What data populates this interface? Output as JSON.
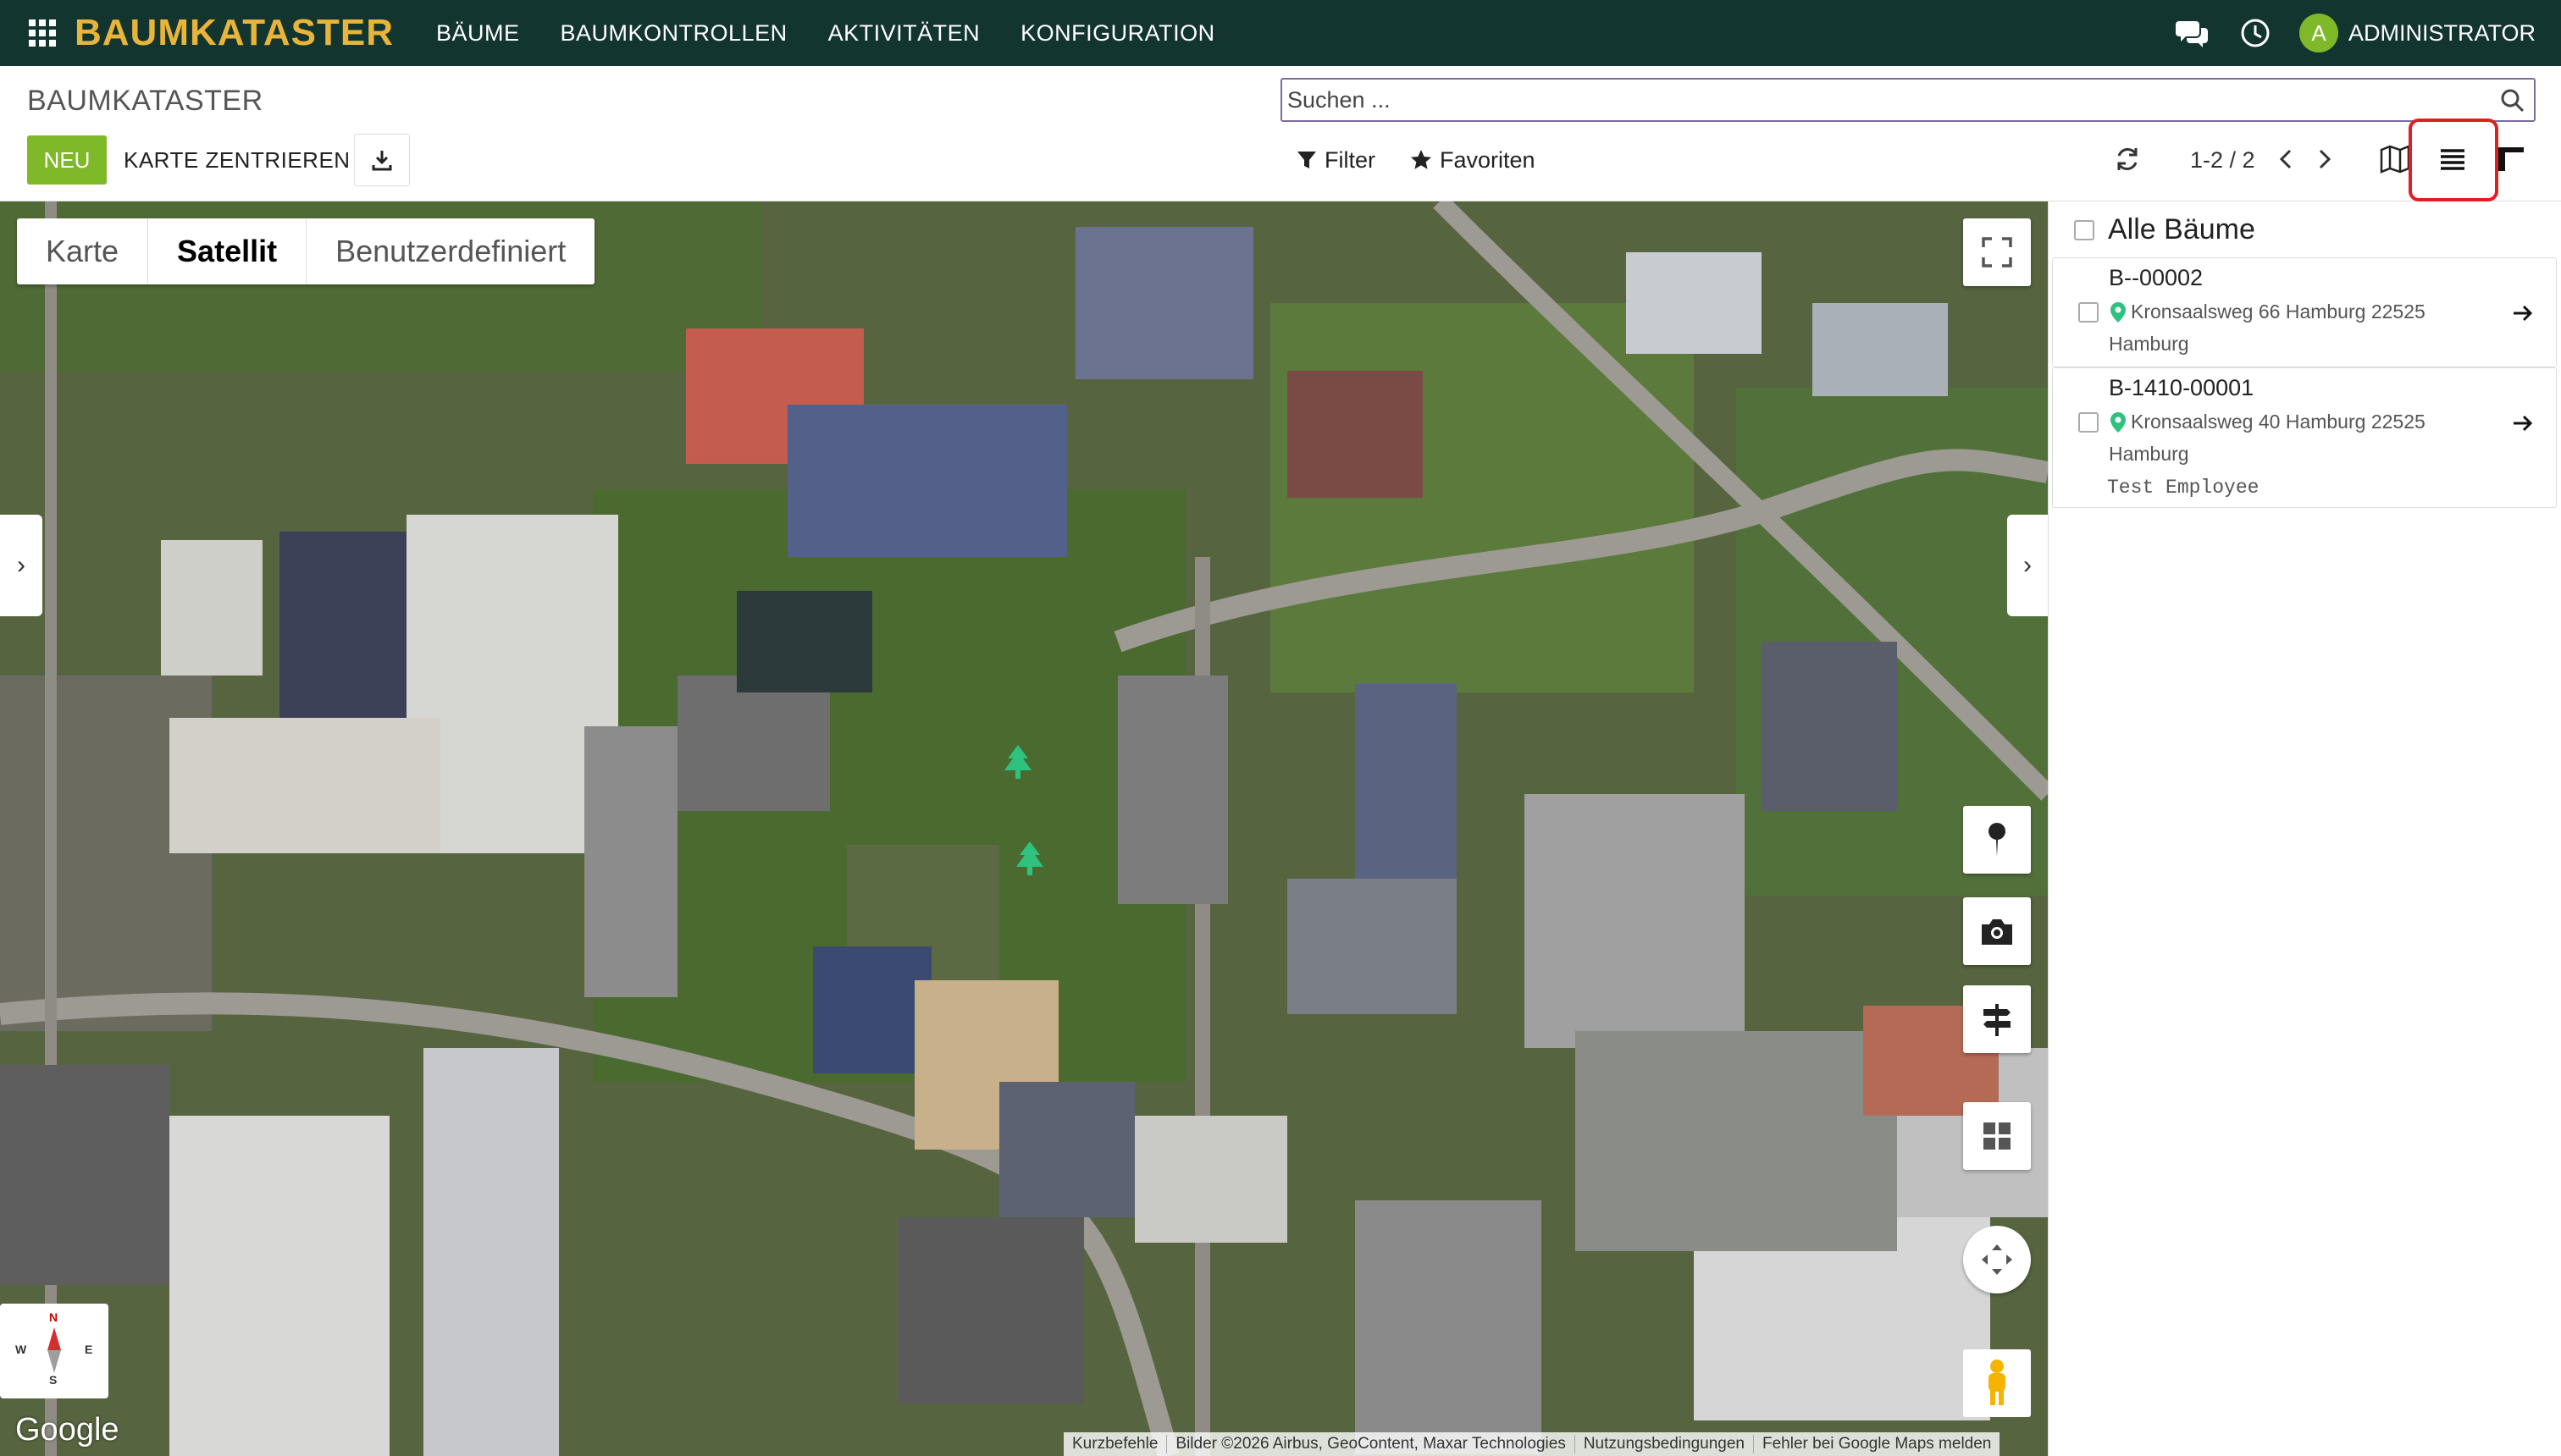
{
  "navbar": {
    "brand": "BAUMKATASTER",
    "menu": [
      "BÄUME",
      "BAUMKONTROLLEN",
      "AKTIVITÄTEN",
      "KONFIGURATION"
    ],
    "avatar_initial": "A",
    "user": "ADMINISTRATOR",
    "bg_color": "#13352f",
    "brand_color": "#e8b43a"
  },
  "control_panel": {
    "breadcrumb": "BAUMKATASTER",
    "search_placeholder": "Suchen ...",
    "new_label": "NEU",
    "center_label": "KARTE ZENTRIEREN",
    "filter_label": "Filter",
    "favorites_label": "Favoriten",
    "pager": "1-2 / 2",
    "accent_color": "#7fb92a"
  },
  "map": {
    "types": [
      "Karte",
      "Satellit",
      "Benutzerdefiniert"
    ],
    "active_type": "Satellit",
    "compass": {
      "n": "N",
      "s": "S",
      "w": "W",
      "e": "E"
    },
    "google": "Google",
    "attribution": [
      "Kurzbefehle",
      "Bilder ©2026 Airbus, GeoContent, Maxar Technologies",
      "Nutzungsbedingungen",
      "Fehler bei Google Maps melden"
    ]
  },
  "list": {
    "title": "Alle Bäume",
    "items": [
      {
        "ref": "B--00002",
        "address": "Kronsaalsweg 66 Hamburg 22525",
        "city": "Hamburg",
        "employee": ""
      },
      {
        "ref": "B-1410-00001",
        "address": "Kronsaalsweg 40 Hamburg 22525",
        "city": "Hamburg",
        "employee": "Test Employee"
      }
    ]
  }
}
